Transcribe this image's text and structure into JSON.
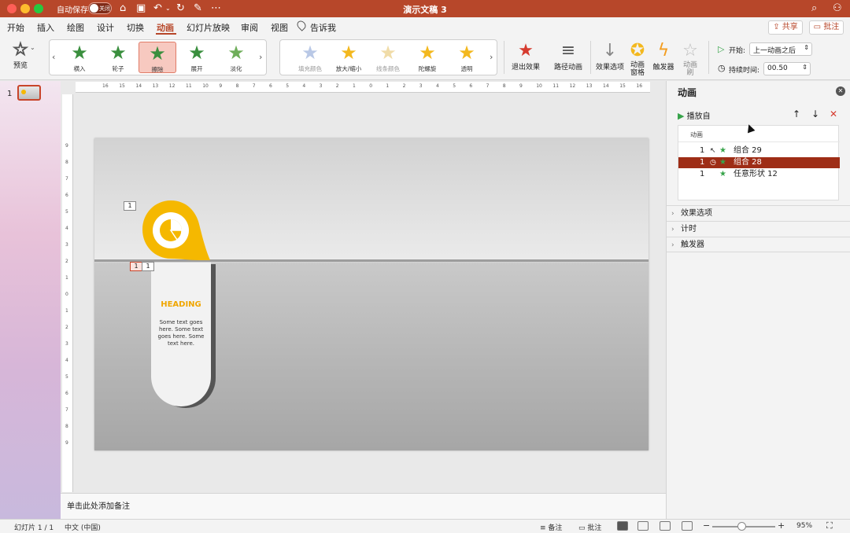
{
  "window": {
    "title": "演示文稿 3",
    "autosave_label": "自动保存",
    "autosave_state": "关闭"
  },
  "tabs": [
    {
      "label": "开始"
    },
    {
      "label": "插入"
    },
    {
      "label": "绘图"
    },
    {
      "label": "设计"
    },
    {
      "label": "切换"
    },
    {
      "label": "动画"
    },
    {
      "label": "幻灯片放映"
    },
    {
      "label": "审阅"
    },
    {
      "label": "视图"
    },
    {
      "label": "告诉我"
    }
  ],
  "active_tab": "动画",
  "share_label": "共享",
  "comment_label": "批注",
  "ribbon": {
    "preview_label": "预览",
    "entrance_effects": [
      {
        "label": "横入",
        "color": "#3a8f3e"
      },
      {
        "label": "轮子",
        "color": "#3a8f3e"
      },
      {
        "label": "擦除",
        "color": "#3a8f3e",
        "selected": true
      },
      {
        "label": "展开",
        "color": "#3a8f3e"
      },
      {
        "label": "淡化",
        "color": "#3a8f3e"
      }
    ],
    "emphasis_effects": [
      {
        "label": "填充颜色",
        "color": "#b9c8e6"
      },
      {
        "label": "放大/缩小",
        "color": "#f3b81e"
      },
      {
        "label": "线条颜色",
        "color": "#f0dca8"
      },
      {
        "label": "陀螺旋",
        "color": "#f3b81e"
      },
      {
        "label": "透明",
        "color": "#f3b81e"
      }
    ],
    "exit_effects_label": "退出效果",
    "path_animation_label": "路径动画",
    "effect_options_label": "效果选项",
    "animation_pane_label_1": "动画",
    "animation_pane_label_2": "窗格",
    "trigger_label": "触发器",
    "animation_painter_label_1": "动画",
    "animation_painter_label_2": "刷",
    "start_label": "开始:",
    "start_value": "上一动画之后",
    "duration_label": "持续时间:",
    "duration_value": "00.50"
  },
  "thumbnails": [
    {
      "number": "1"
    }
  ],
  "slide": {
    "heading": "HEADING",
    "body": "Some text goes here. Some text goes here. Some text here.",
    "tags": [
      "1",
      "1",
      "1"
    ],
    "accent_color": "#f5b800"
  },
  "rulers": {
    "top": [
      "16",
      "15",
      "14",
      "13",
      "12",
      "11",
      "10",
      "9",
      "8",
      "7",
      "6",
      "5",
      "4",
      "3",
      "2",
      "1",
      "0",
      "1",
      "2",
      "3",
      "4",
      "5",
      "6",
      "7",
      "8",
      "9",
      "10",
      "11",
      "12",
      "13",
      "14",
      "15",
      "16"
    ],
    "left": [
      "9",
      "8",
      "7",
      "6",
      "5",
      "4",
      "3",
      "2",
      "1",
      "0",
      "1",
      "2",
      "3",
      "4",
      "5",
      "6",
      "7",
      "8",
      "9"
    ]
  },
  "notes_placeholder": "单击此处添加备注",
  "anim_pane": {
    "title": "动画",
    "play_from_label": "播放自",
    "list_header": "动画",
    "items": [
      {
        "order": "1",
        "name": "组合 29",
        "trigger": "click"
      },
      {
        "order": "1",
        "name": "组合 28",
        "trigger": "after",
        "selected": true
      },
      {
        "order": "1",
        "name": "任意形状 12",
        "trigger": ""
      }
    ],
    "sections": [
      {
        "label": "效果选项"
      },
      {
        "label": "计时"
      },
      {
        "label": "触发器"
      }
    ]
  },
  "status": {
    "slide_info": "幻灯片 1 / 1",
    "language": "中文 (中国)",
    "notes_label": "备注",
    "comments_label": "批注",
    "zoom": "95%"
  }
}
